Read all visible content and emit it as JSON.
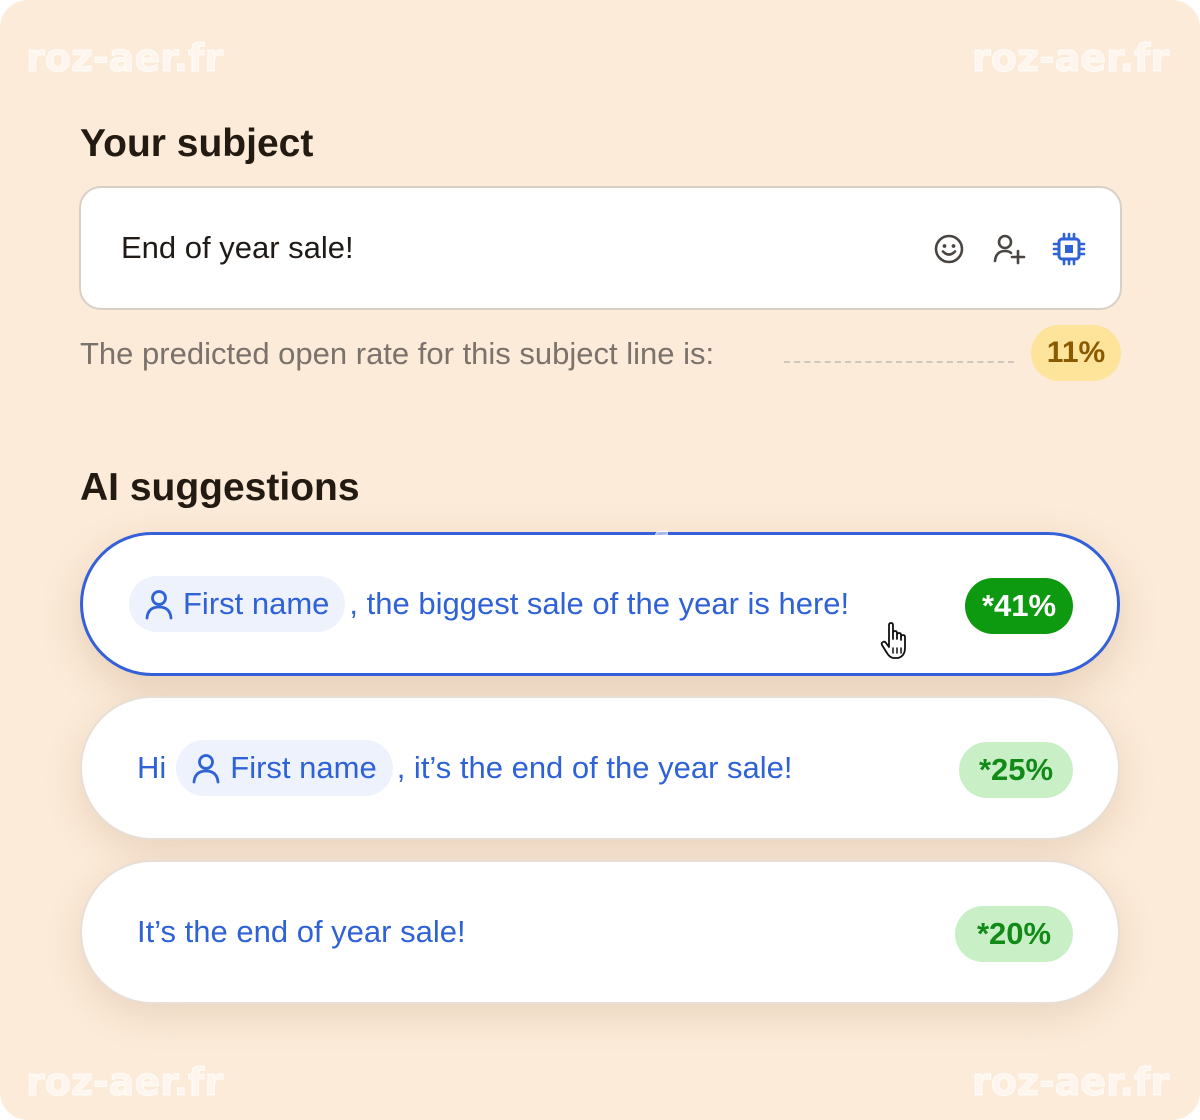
{
  "watermark": "roz-aer.fr",
  "subject": {
    "title": "Your subject",
    "value": "End of year sale!",
    "icons": [
      "emoji-icon",
      "add-person-icon",
      "ai-chip-icon"
    ]
  },
  "prediction": {
    "text": "The predicted open rate for this subject line is:",
    "rate": "11%"
  },
  "suggestions": {
    "title": "AI suggestions",
    "items": [
      {
        "prefix": "",
        "chip": "First name",
        "text": ", the biggest sale of the year is here!",
        "rate": "*41%",
        "selected": true
      },
      {
        "prefix": "Hi",
        "chip": "First name",
        "text": ", it’s the end of the year sale!",
        "rate": "*25%",
        "selected": false
      },
      {
        "prefix": "",
        "chip": "",
        "text": "It’s the end of year sale!",
        "rate": "*20%",
        "selected": false
      }
    ]
  },
  "colors": {
    "background": "#fcebd9",
    "accent_blue": "#2f62d6",
    "selected_border": "#3560d8",
    "top_rate_green": "#0e9a10",
    "rate_green_light": "#c9efc6",
    "predict_badge": "#fde49a"
  }
}
